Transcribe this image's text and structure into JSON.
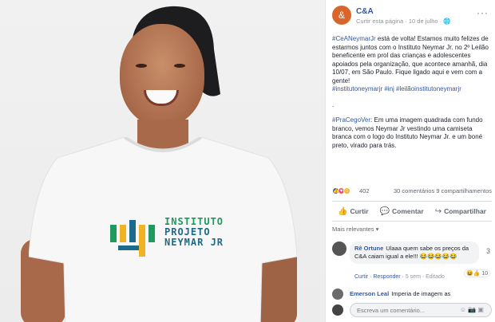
{
  "photo": {
    "logo_line1": "INSTITUTO",
    "logo_line2": "PROJETO",
    "logo_line3": "NEYMAR JR"
  },
  "post_header": {
    "page_initial": "&",
    "page_name": "C&A",
    "meta": "Curtir esta página · 10 de julho · 🌐",
    "more": "···"
  },
  "post": {
    "para1_tag": "#CeANeymarJr",
    "para1_text": " está de volta! Estamos muito felizes de estarmos juntos com o Instituto Neymar Jr. no 2º Leilão beneficente em prol das crianças e adolescentes apoiados pela organização, que acontece amanhã, dia 10/07, em São Paulo. Fique ligado aqui e vem com a gente!",
    "para1_tags_end": "#institutoneymarjr #inj #leilãoinstitutoneymarjr",
    "dot": ".",
    "para2_tag": "#PraCegoVer",
    "para2_text": ": Em uma imagem quadrada com fundo branco, vemos Neymar Jr vestindo uma camiseta branca com o logo do Instituto Neymar Jr. e um boné preto, virado para trás."
  },
  "stats": {
    "reaction_count": "402",
    "comments": "30 comentários",
    "shares": "9 compartilhamentos"
  },
  "actions": {
    "like": "Curtir",
    "comment": "Comentar",
    "share": "Compartilhar"
  },
  "comments_filter": "Mais relevantes ▾",
  "comment1": {
    "author": "Rê Ortune",
    "text": "Ulaaa quem sabe os preços da C&A caiam igual a ele!!! 😂😂😂😂😂",
    "like": "Curtir",
    "reply": "Responder",
    "time": "5 sem",
    "edited": "Editado",
    "reaction_count": "😆👍 10",
    "bracket": "3"
  },
  "comment2": {
    "author": "Emerson Leal",
    "snippet": "Imperia de imagem as"
  },
  "composer": {
    "placeholder": "Escreva um comentário...",
    "icons": "☺ 📷 ▣"
  },
  "colors": {
    "link": "#365899",
    "brand": "#d9652a",
    "like_blue": "#4267b2",
    "love_red": "#f25268",
    "haha_yellow": "#f7b125"
  }
}
